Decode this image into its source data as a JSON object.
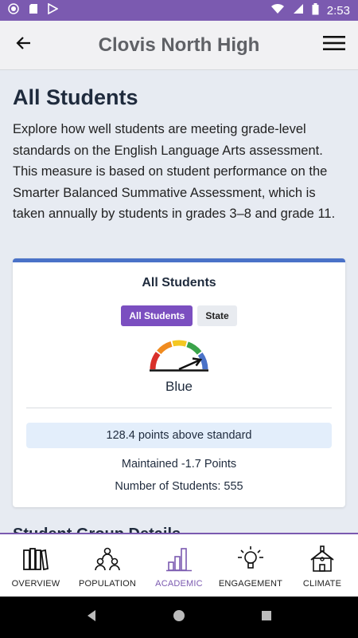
{
  "status_bar": {
    "time": "2:53"
  },
  "app_bar": {
    "title": "Clovis North High",
    "back_icon": "arrow-left-icon",
    "menu_icon": "hamburger-menu-icon"
  },
  "page": {
    "title": "All Students",
    "description": "Explore how well students are meeting grade-level standards on the English Language Arts assessment. This measure is based on student performance on the Smarter Balanced Summative Assessment, which is taken annually by students in grades 3–8 and grade 11."
  },
  "card": {
    "title": "All Students",
    "toggles": [
      {
        "label": "All Students",
        "active": true
      },
      {
        "label": "State",
        "active": false
      }
    ],
    "gauge_icon": "performance-gauge-icon",
    "gauge_colors": [
      "#d9302a",
      "#f08b1f",
      "#f4c721",
      "#3aa34a",
      "#4a72c8"
    ],
    "status": "Blue",
    "highlight": "128.4 points above standard",
    "change": "Maintained -1.7 Points",
    "count": "Number of Students: 555"
  },
  "next_section_title": "Student Group Details",
  "tabs": [
    {
      "label": "OVERVIEW",
      "icon": "books-icon",
      "active": false
    },
    {
      "label": "POPULATION",
      "icon": "people-group-icon",
      "active": false
    },
    {
      "label": "ACADEMIC",
      "icon": "bar-chart-icon",
      "active": true
    },
    {
      "label": "ENGAGEMENT",
      "icon": "lightbulb-icon",
      "active": false
    },
    {
      "label": "CLIMATE",
      "icon": "schoolhouse-icon",
      "active": false
    }
  ],
  "colors": {
    "accent": "#7b5ab0",
    "active_toggle": "#7b4fc0",
    "card_border": "#4a72c8"
  }
}
